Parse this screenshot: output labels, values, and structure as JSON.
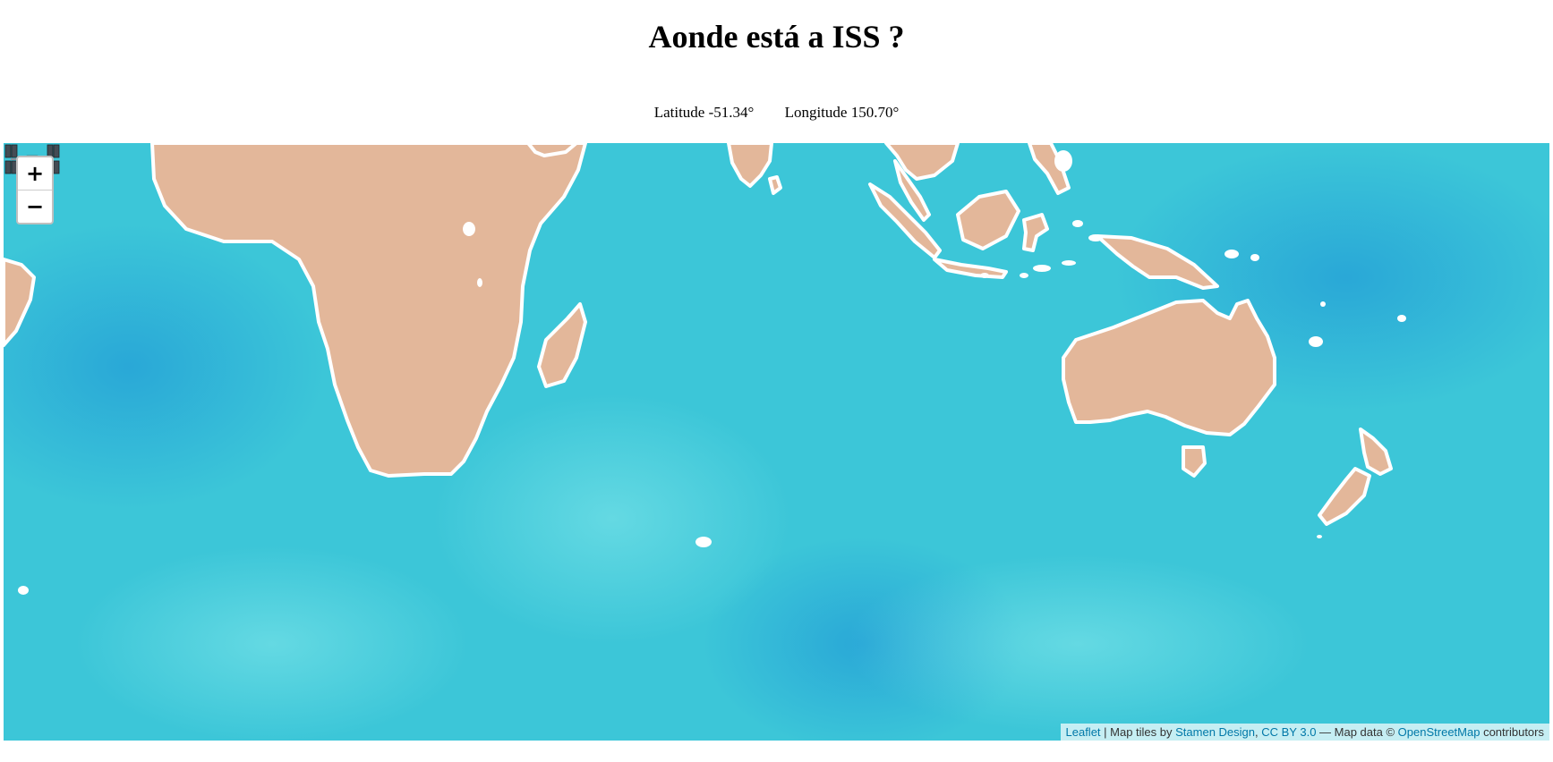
{
  "page": {
    "title": "Aonde está a ISS ?",
    "latitude_label": "Latitude",
    "latitude_value": "-51.34°",
    "longitude_label": "Longitude",
    "longitude_value": "150.70°"
  },
  "iss_position": {
    "latitude": -51.34,
    "longitude": 150.7
  },
  "map": {
    "tile_style": "watercolor",
    "ocean_color": "#3cc6d8",
    "land_color": "#e3b79a",
    "zoom_in_label": "+",
    "zoom_out_label": "−",
    "marker_icon": "iss-satellite-icon"
  },
  "attribution": {
    "leaflet": "Leaflet",
    "sep1": " | Map tiles by ",
    "stamen": "Stamen Design",
    "comma": ", ",
    "license": "CC BY 3.0",
    "sep2": " — Map data © ",
    "osm": "OpenStreetMap",
    "contributors": " contributors"
  }
}
